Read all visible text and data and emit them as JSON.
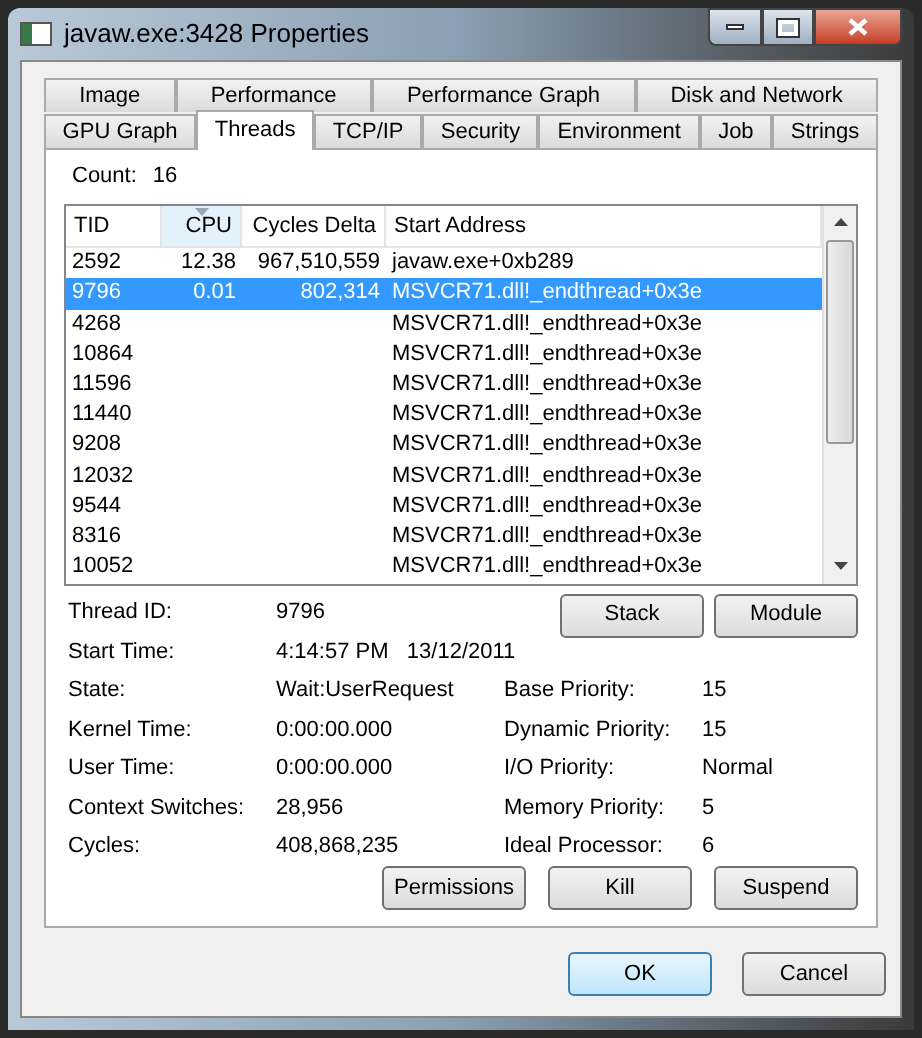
{
  "window": {
    "title": "javaw.exe:3428 Properties"
  },
  "tab_rows": [
    [
      {
        "label": "Image",
        "selected": false
      },
      {
        "label": "Performance",
        "selected": false
      },
      {
        "label": "Performance Graph",
        "selected": false
      },
      {
        "label": "Disk and Network",
        "selected": false
      }
    ],
    [
      {
        "label": "GPU Graph",
        "selected": false
      },
      {
        "label": "Threads",
        "selected": true
      },
      {
        "label": "TCP/IP",
        "selected": false
      },
      {
        "label": "Security",
        "selected": false
      },
      {
        "label": "Environment",
        "selected": false
      },
      {
        "label": "Job",
        "selected": false
      },
      {
        "label": "Strings",
        "selected": false
      }
    ]
  ],
  "count": {
    "label": "Count:",
    "value": "16"
  },
  "table": {
    "columns": [
      {
        "label": "TID",
        "sorted": false
      },
      {
        "label": "CPU",
        "sorted": true
      },
      {
        "label": "Cycles Delta",
        "sorted": false
      },
      {
        "label": "Start Address",
        "sorted": false
      }
    ],
    "rows": [
      {
        "cells": [
          "2592",
          "12.38",
          "967,510,559",
          "javaw.exe+0xb289"
        ],
        "selected": false
      },
      {
        "cells": [
          "9796",
          "0.01",
          "802,314",
          "MSVCR71.dll!_endthread+0x3e"
        ],
        "selected": true
      },
      {
        "cells": [
          "4268",
          "",
          "",
          "MSVCR71.dll!_endthread+0x3e"
        ],
        "selected": false
      },
      {
        "cells": [
          "10864",
          "",
          "",
          "MSVCR71.dll!_endthread+0x3e"
        ],
        "selected": false
      },
      {
        "cells": [
          "11596",
          "",
          "",
          "MSVCR71.dll!_endthread+0x3e"
        ],
        "selected": false
      },
      {
        "cells": [
          "11440",
          "",
          "",
          "MSVCR71.dll!_endthread+0x3e"
        ],
        "selected": false
      },
      {
        "cells": [
          "9208",
          "",
          "",
          "MSVCR71.dll!_endthread+0x3e"
        ],
        "selected": false
      },
      {
        "cells": [
          "12032",
          "",
          "",
          "MSVCR71.dll!_endthread+0x3e"
        ],
        "selected": false
      },
      {
        "cells": [
          "9544",
          "",
          "",
          "MSVCR71.dll!_endthread+0x3e"
        ],
        "selected": false
      },
      {
        "cells": [
          "8316",
          "",
          "",
          "MSVCR71.dll!_endthread+0x3e"
        ],
        "selected": false
      },
      {
        "cells": [
          "10052",
          "",
          "",
          "MSVCR71.dll!_endthread+0x3e"
        ],
        "selected": false
      }
    ]
  },
  "list_buttons": [
    "Stack",
    "Module"
  ],
  "details": [
    {
      "label": "Thread ID:",
      "value": "9796"
    },
    {
      "label": "Start Time:",
      "value": "4:14:57 PM   13/12/2011"
    },
    {
      "label": "State:",
      "value": "Wait:UserRequest",
      "label2": "Base Priority:",
      "value2": "15"
    },
    {
      "label": "Kernel Time:",
      "value": "0:00:00.000",
      "label2": "Dynamic Priority:",
      "value2": "15"
    },
    {
      "label": "User Time:",
      "value": "0:00:00.000",
      "label2": "I/O Priority:",
      "value2": "Normal"
    },
    {
      "label": "Context Switches:",
      "value": "28,956",
      "label2": "Memory Priority:",
      "value2": "5"
    },
    {
      "label": "Cycles:",
      "value": "408,868,235",
      "label2": "Ideal Processor:",
      "value2": "6"
    }
  ],
  "thread_buttons": [
    "Permissions",
    "Kill",
    "Suspend"
  ],
  "dialog_buttons": [
    {
      "label": "OK",
      "default": true
    },
    {
      "label": "Cancel",
      "default": false
    }
  ]
}
